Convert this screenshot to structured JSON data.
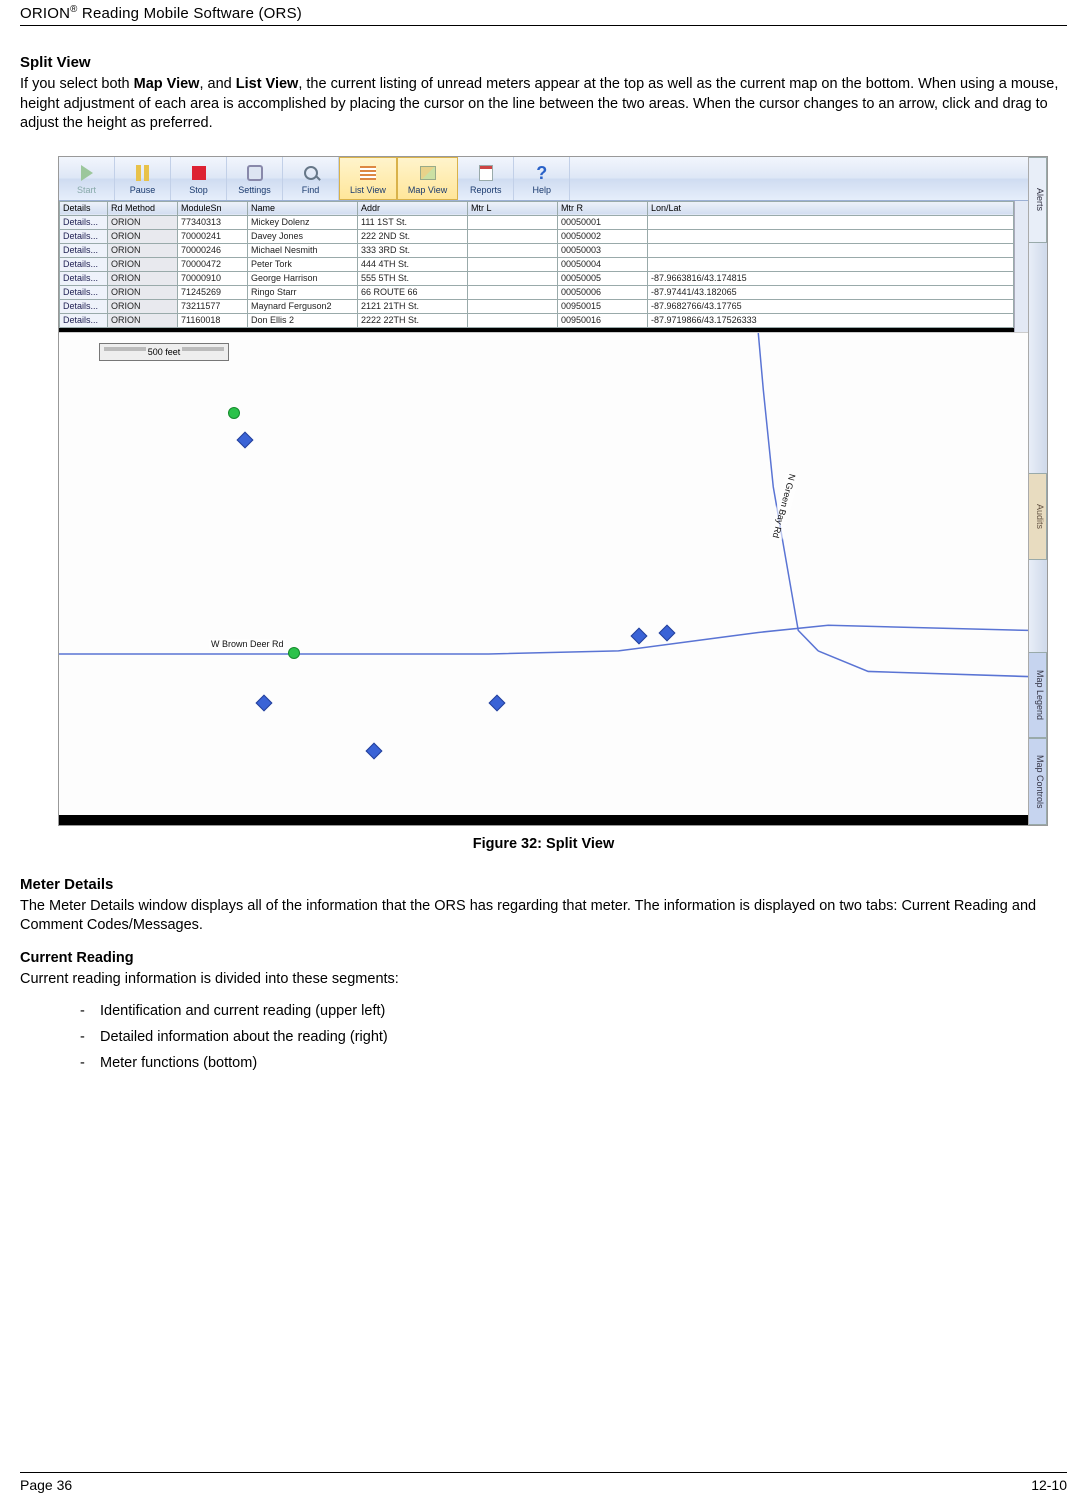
{
  "header": {
    "product": "ORION",
    "reg": "®",
    "rest": " Reading Mobile Software (ORS)"
  },
  "split": {
    "heading": "Split View",
    "para_pre": "If you select both ",
    "bold1": "Map View",
    "mid1": ", and ",
    "bold2": "List View",
    "para_post": ", the current listing of unread meters appear at the top as well as the current map on the bottom.   When using a mouse, height adjustment of each area is accomplished by placing the cursor on the line between the two areas.  When the cursor changes to an arrow, click and drag to adjust the height as preferred."
  },
  "toolbar": {
    "start": "Start",
    "pause": "Pause",
    "stop": "Stop",
    "settings": "Settings",
    "find": "Find",
    "listview": "List View",
    "mapview": "Map View",
    "reports": "Reports",
    "help": "Help"
  },
  "grid": {
    "headers": [
      "Details",
      "Rd Method",
      "ModuleSn",
      "Name",
      "Addr",
      "Mtr L",
      "Mtr R",
      "Lon/Lat"
    ],
    "rows": [
      [
        "Details...",
        "ORION",
        "77340313",
        "Mickey Dolenz",
        "111 1ST St.",
        "",
        "00050001",
        ""
      ],
      [
        "Details...",
        "ORION",
        "70000241",
        "Davey Jones",
        "222 2ND St.",
        "",
        "00050002",
        ""
      ],
      [
        "Details...",
        "ORION",
        "70000246",
        "Michael Nesmith",
        "333 3RD St.",
        "",
        "00050003",
        ""
      ],
      [
        "Details...",
        "ORION",
        "70000472",
        "Peter Tork",
        "444 4TH St.",
        "",
        "00050004",
        ""
      ],
      [
        "Details...",
        "ORION",
        "70000910",
        "George Harrison",
        "555 5TH St.",
        "",
        "00050005",
        "-87.9663816/43.174815"
      ],
      [
        "Details...",
        "ORION",
        "71245269",
        "Ringo Starr",
        "66 ROUTE 66",
        "",
        "00050006",
        "-87.97441/43.182065"
      ],
      [
        "Details...",
        "ORION",
        "73211577",
        "Maynard Ferguson2",
        "2121 21TH St.",
        "",
        "00950015",
        "-87.9682766/43.17765"
      ],
      [
        "Details...",
        "ORION",
        "71160018",
        "Don Ellis 2",
        "2222 22TH St.",
        "",
        "00950016",
        "-87.9719866/43.17526333"
      ]
    ]
  },
  "map": {
    "scale": "500 feet",
    "road_h": "W Brown Deer Rd",
    "road_v": "N Green Bay Rd"
  },
  "rail": {
    "t1": "Alerts",
    "t2": "Audits",
    "t3": "Map Legend",
    "t4": "Map Controls"
  },
  "caption": "Figure 32: Split View",
  "meter": {
    "heading": "Meter Details",
    "para": "The Meter Details window displays all of the information that the ORS has regarding that meter.  The information is displayed on two tabs:  Current Reading and Comment Codes/Messages.",
    "sub": "Current Reading",
    "lead": "Current reading information is divided into these segments:",
    "b1": "Identification and current reading (upper left)",
    "b2": "Detailed information about the reading (right)",
    "b3": "Meter functions (bottom)"
  },
  "footer": {
    "left": "Page 36",
    "right": "12-10"
  }
}
